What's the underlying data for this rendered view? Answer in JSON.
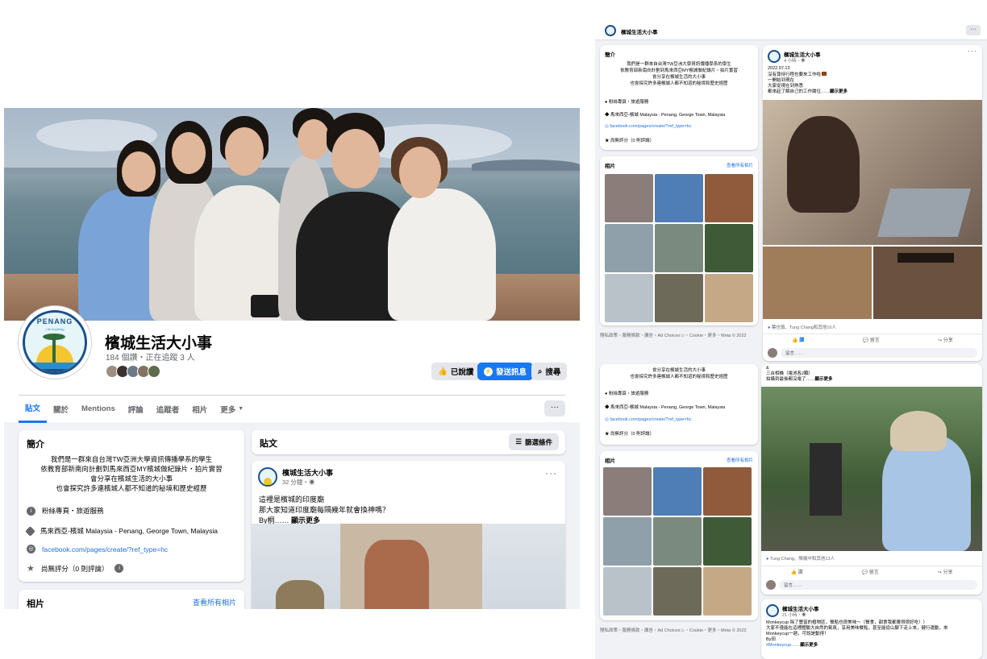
{
  "page": {
    "name": "檳城生活大小事",
    "meta": "184 個讚・正在追蹤 3 人",
    "avatar_title": "PENANG",
    "avatar_sub": "Life Anything"
  },
  "buttons": {
    "liked": "已說讚",
    "message": "發送訊息",
    "search": "搜尋"
  },
  "tabs": [
    "貼文",
    "關於",
    "Mentions",
    "評論",
    "追蹤者",
    "相片",
    "更多"
  ],
  "tab_more_button": "···",
  "intro": {
    "title": "簡介",
    "lines": [
      "我們是一群來自台灣TW亞洲大學資訊傳播學系的學生",
      "依教育部新南向計劃到馬來西亞MY檳城做紀錄片・拍片實習",
      "會分享在檳城生活的大小事",
      "也會探究許多連檳城人都不知道的秘境和歷史經歷"
    ],
    "category": "粉絲專頁・旅遊服務",
    "location": "馬來西亞-檳城 Malaysia - Penang, George Town, Malaysia",
    "website": "facebook.com/pages/create/?ref_type=hc",
    "rating": "尚無評分（0 則評論）"
  },
  "photos": {
    "title": "相片",
    "see_all": "查看所有相片"
  },
  "posts_card": {
    "title": "貼文",
    "filter": "篩選條件"
  },
  "left_post": {
    "author": "檳城生活大小事",
    "time": "32 分鐘・",
    "lines": [
      "這裡是檳城的印度廟",
      "那大家知道印度廟每隔幾年就會換神嗎？"
    ],
    "by": "By桐……",
    "more": "顯示更多"
  },
  "right_header": {
    "title": "檳城生活大小事",
    "more": "···"
  },
  "right_post1": {
    "author": "檳城生活大小事",
    "time": "4 小時・",
    "lines": [
      "2022.07.13",
      "沒有尊持行程也要來工作啦",
      "一開始到現在",
      "大家從現在到熟悉"
    ],
    "tail": "都來起了解自己的工作崗位……",
    "more": "顯示更多",
    "reactions": "葉也慎、Tung Chang和其他16人",
    "like": "讚",
    "comment": "留言",
    "share": "分享",
    "comment_placeholder": "留言……"
  },
  "right_post2": {
    "lines": [
      "&",
      "三台相機（電池各2顆）"
    ],
    "tail": "拍攝到最後都沒電了……",
    "more": "顯示更多",
    "reactions": "Tung Chang、陳儀中和其他13人",
    "like": "讚",
    "comment": "留言",
    "share": "分享",
    "comment_placeholder": "留言……"
  },
  "right_post3": {
    "author": "檳城生活大小事",
    "time": "21 小時・",
    "lines": [
      "Monkeycup 除了豐富的植物區，餐點也很美味～（餐食，甜食我都覺得很好吃！）",
      "大家不僅能在這裡體驗大自然的氣氛，享用美味餐點，甚至能從山腳下走上來，健行運動，來",
      "Monkeycup一趟，可說是動得！",
      "By田"
    ],
    "tag": "#Monkeycup……",
    "more": "顯示更多"
  },
  "footer": "隱私政策・服務條款・廣告・Ad Choices ▷・Cookie・更多・Meta © 2022",
  "colors": {
    "fb_blue": "#1877f2",
    "link": "#216fdb",
    "bg": "#f0f2f5",
    "secondary_text": "#65676b"
  },
  "icons": [
    "like-icon",
    "messenger-icon",
    "search-icon",
    "filter-icon",
    "info-icon",
    "map-pin-icon",
    "globe-icon",
    "star-icon",
    "more-dots-icon"
  ]
}
